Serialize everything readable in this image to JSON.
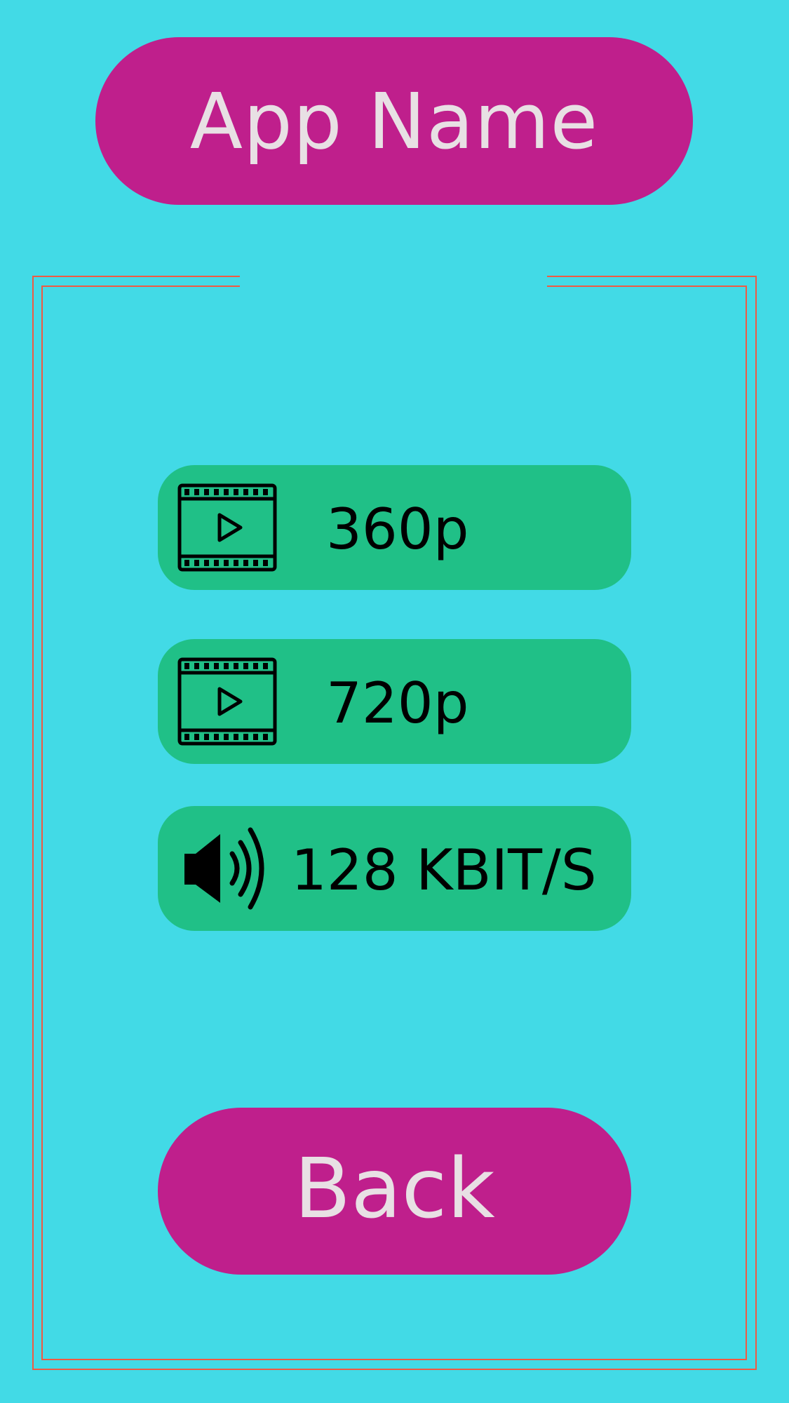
{
  "header": {
    "app_name": "App Name"
  },
  "options": [
    {
      "label": "360p",
      "icon": "film-icon"
    },
    {
      "label": "720p",
      "icon": "film-icon"
    },
    {
      "label": "128 KBIT/S",
      "icon": "speaker-icon"
    }
  ],
  "footer": {
    "back_label": "Back"
  },
  "colors": {
    "background": "#42dae6",
    "accent": "#bf1f8c",
    "option_button": "#20c087",
    "frame": "#ef5a43",
    "light_text": "#e8e0e4"
  }
}
